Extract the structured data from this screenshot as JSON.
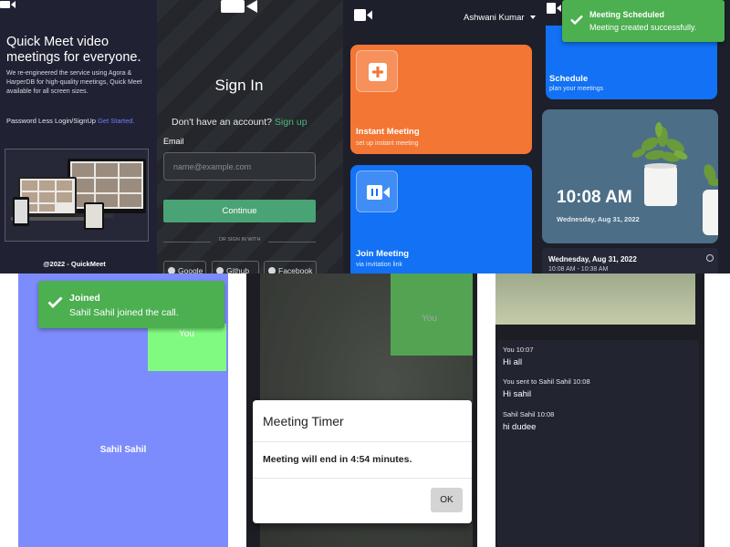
{
  "landing": {
    "headline": "Quick Meet video meetings for everyone.",
    "description": "We re-engineered the service using Agora & HarperDB for high-quality meetings, Quick Meet available for all screen sizes.",
    "passwordless_label": "Password Less Login/SignUp",
    "get_started_link": "Get Started.",
    "footer": "@2022 - QuickMeet"
  },
  "signin": {
    "title": "Sign In",
    "no_account_text": "Don't have an account?",
    "signup_link": "Sign up",
    "email_label": "Email",
    "email_placeholder": "name@example.com",
    "continue_button": "Continue",
    "divider_text": "OR SIGN IN WITH",
    "social": [
      "Google",
      "Github",
      "Facebook"
    ]
  },
  "dashboard": {
    "user_name": "Ashwani Kumar",
    "instant": {
      "title": "Instant Meeting",
      "subtitle": "set up instant meeting"
    },
    "join": {
      "title": "Join Meeting",
      "subtitle": "via invitation link"
    },
    "colors": {
      "orange": "#f47634",
      "blue": "#1271f4"
    }
  },
  "schedule": {
    "title": "Schedule",
    "subtitle": "plan your meetings",
    "clock_time": "10:08 AM",
    "clock_date": "Wednesday, Aug 31, 2022",
    "meeting_date": "Wednesday, Aug 31, 2022",
    "meeting_range": "10:08 AM - 10:38 AM",
    "toast_title": "Meeting Scheduled",
    "toast_body": "Meeting created successfully."
  },
  "call": {
    "self_label": "You",
    "participant_name": "Sahil Sahil",
    "toast_title": "Joined",
    "toast_body": "Sahil Sahil joined the call.",
    "tile_color": "#7d8cfd",
    "self_color": "#80fb80"
  },
  "timer": {
    "self_label": "You",
    "title": "Meeting Timer",
    "body": "Meeting will end in 4:54 minutes.",
    "ok_button": "OK"
  },
  "chat": {
    "messages": [
      {
        "meta": "You 10:07",
        "text": "Hi all"
      },
      {
        "meta": "You sent to Sahil Sahil 10:08",
        "text": "Hi sahil"
      },
      {
        "meta": "Sahil Sahil 10:08",
        "text": "hi dudee"
      }
    ]
  }
}
